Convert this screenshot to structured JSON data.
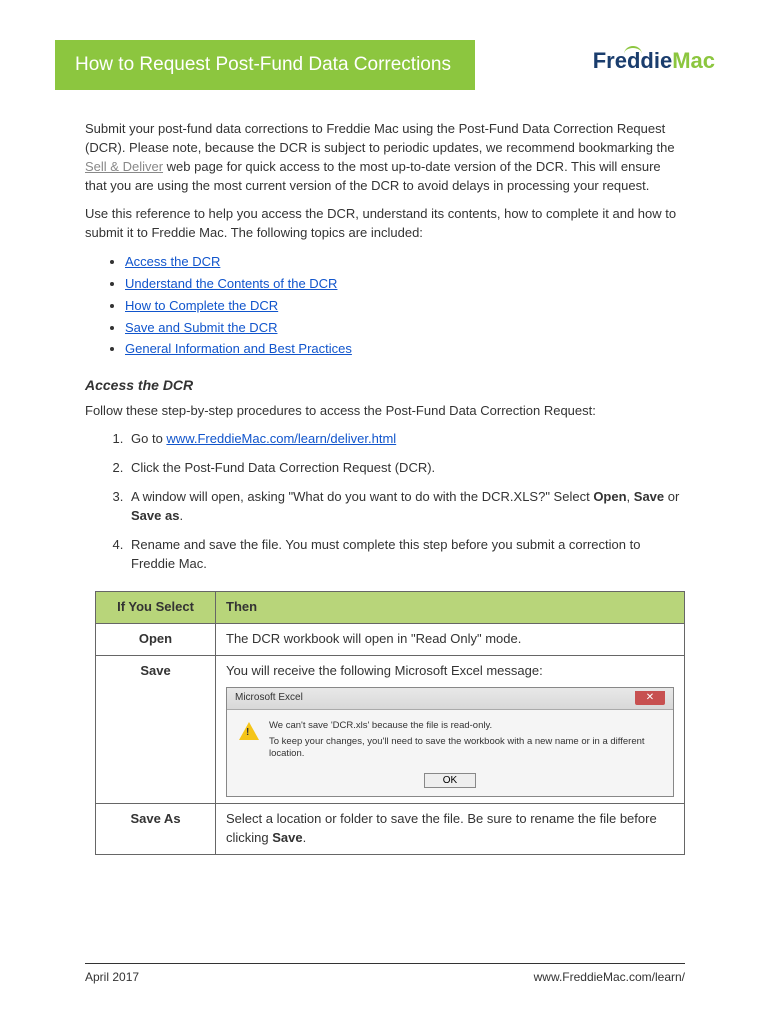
{
  "header": {
    "title": "How to Request Post-Fund Data Corrections",
    "logo_freddie": "Freddie",
    "logo_mac": "Mac"
  },
  "intro": {
    "p1_a": "Submit your post-fund data corrections to Freddie Mac using the Post-Fund Data Correction Request (DCR). Please note, because the DCR is subject to periodic updates, we recommend bookmarking the ",
    "p1_link": "Sell & Deliver",
    "p1_b": " web page for quick access to the most up-to-date version of the DCR. This will ensure that you are using the most current version of the DCR to avoid delays in processing your request.",
    "p2": "Use this reference to help you access the DCR, understand its contents, how to complete it and how to submit it to Freddie Mac. The following topics are included:"
  },
  "toc": [
    "Access the DCR",
    "Understand the Contents of the DCR",
    "How to Complete the DCR",
    "Save and Submit the DCR",
    "General Information and Best Practices"
  ],
  "access": {
    "heading": "Access the DCR",
    "intro": "Follow these step-by-step procedures to access the Post-Fund Data Correction Request:",
    "steps": {
      "s1_a": "Go to  ",
      "s1_link": "www.FreddieMac.com/learn/deliver.html",
      "s2": "Click the Post-Fund Data Correction Request (DCR).",
      "s3_a": "A window will open, asking \"What do you want to do with the DCR.XLS?\"  Select ",
      "s3_b1": "Open",
      "s3_c": ", ",
      "s3_b2": "Save",
      "s3_d": " or ",
      "s3_b3": "Save as",
      "s3_e": ".",
      "s4": "Rename and save the file. You must complete this step before you submit a correction to Freddie Mac."
    }
  },
  "table": {
    "h1": "If You Select",
    "h2": "Then",
    "r1_k": "Open",
    "r1_v": "The DCR workbook will open in \"Read Only\" mode.",
    "r2_k": "Save",
    "r2_v": "You will receive the following Microsoft Excel message:",
    "r3_k": "Save As",
    "r3_v_a": "Select a location or folder to save the file.  Be sure to rename the file before clicking ",
    "r3_v_b": "Save",
    "r3_v_c": "."
  },
  "dialog": {
    "title": "Microsoft Excel",
    "line1": "We can't save 'DCR.xls' because the file is read-only.",
    "line2": "To keep your changes, you'll need to save the workbook with a new name or in a different location.",
    "ok": "OK"
  },
  "footer": {
    "date": "April 2017",
    "url": "www.FreddieMac.com/learn/"
  }
}
